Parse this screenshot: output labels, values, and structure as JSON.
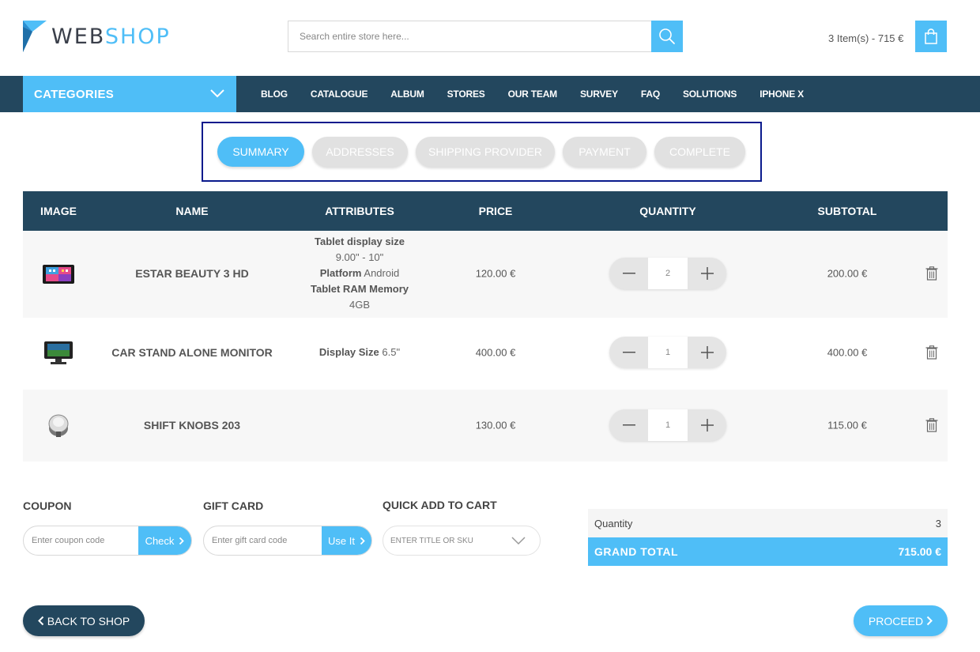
{
  "brand": {
    "part1": "WEB",
    "part2": "SHOP",
    "color_dark": "#3a3f4a",
    "color_accent": "#4fbef7"
  },
  "search": {
    "placeholder": "Search entire store here...",
    "icon": "search-icon"
  },
  "cart": {
    "summary": "3 Item(s) - 715 €",
    "icon": "shopping-bag-icon"
  },
  "nav": {
    "categories_label": "CATEGORIES",
    "items": [
      "BLOG",
      "CATALOGUE",
      "ALBUM",
      "STORES",
      "OUR TEAM",
      "SURVEY",
      "FAQ",
      "SOLUTIONS",
      "IPHONE X"
    ]
  },
  "steps": [
    {
      "label": "SUMMARY",
      "active": true
    },
    {
      "label": "ADDRESSES",
      "active": false
    },
    {
      "label": "SHIPPING PROVIDER",
      "active": false
    },
    {
      "label": "PAYMENT",
      "active": false
    },
    {
      "label": "COMPLETE",
      "active": false
    }
  ],
  "table": {
    "headers": [
      "IMAGE",
      "NAME",
      "ATTRIBUTES",
      "PRICE",
      "QUANTITY",
      "SUBTOTAL"
    ],
    "rows": [
      {
        "image": "tablet-image",
        "name": "ESTAR BEAUTY 3 HD",
        "attributes": [
          {
            "label": "Tablet display size",
            "value": "9.00\" - 10\""
          },
          {
            "label": "Platform",
            "value": "Android"
          },
          {
            "label": "Tablet RAM Memory",
            "value": "4GB"
          }
        ],
        "price": "120.00 €",
        "quantity": "2",
        "subtotal": "200.00 €"
      },
      {
        "image": "car-monitor-image",
        "name": "CAR STAND ALONE MONITOR",
        "attributes": [
          {
            "label": "Display Size",
            "value": "6.5\""
          }
        ],
        "price": "400.00 €",
        "quantity": "1",
        "subtotal": "400.00 €"
      },
      {
        "image": "shift-knob-image",
        "name": "SHIFT KNOBS 203",
        "attributes": [],
        "price": "130.00 €",
        "quantity": "1",
        "subtotal": "115.00 €"
      }
    ]
  },
  "coupon": {
    "title": "COUPON",
    "placeholder": "Enter coupon code",
    "button": "Check"
  },
  "gift_card": {
    "title": "GIFT CARD",
    "placeholder": "Enter gift card code",
    "button": "Use It"
  },
  "quick_add": {
    "title": "QUICK ADD TO CART",
    "placeholder": "ENTER TITLE OR SKU"
  },
  "totals": {
    "quantity_label": "Quantity",
    "quantity_value": "3",
    "grand_label": "GRAND TOTAL",
    "grand_value": "715.00 €"
  },
  "actions": {
    "back": "BACK TO SHOP",
    "proceed": "PROCEED"
  }
}
